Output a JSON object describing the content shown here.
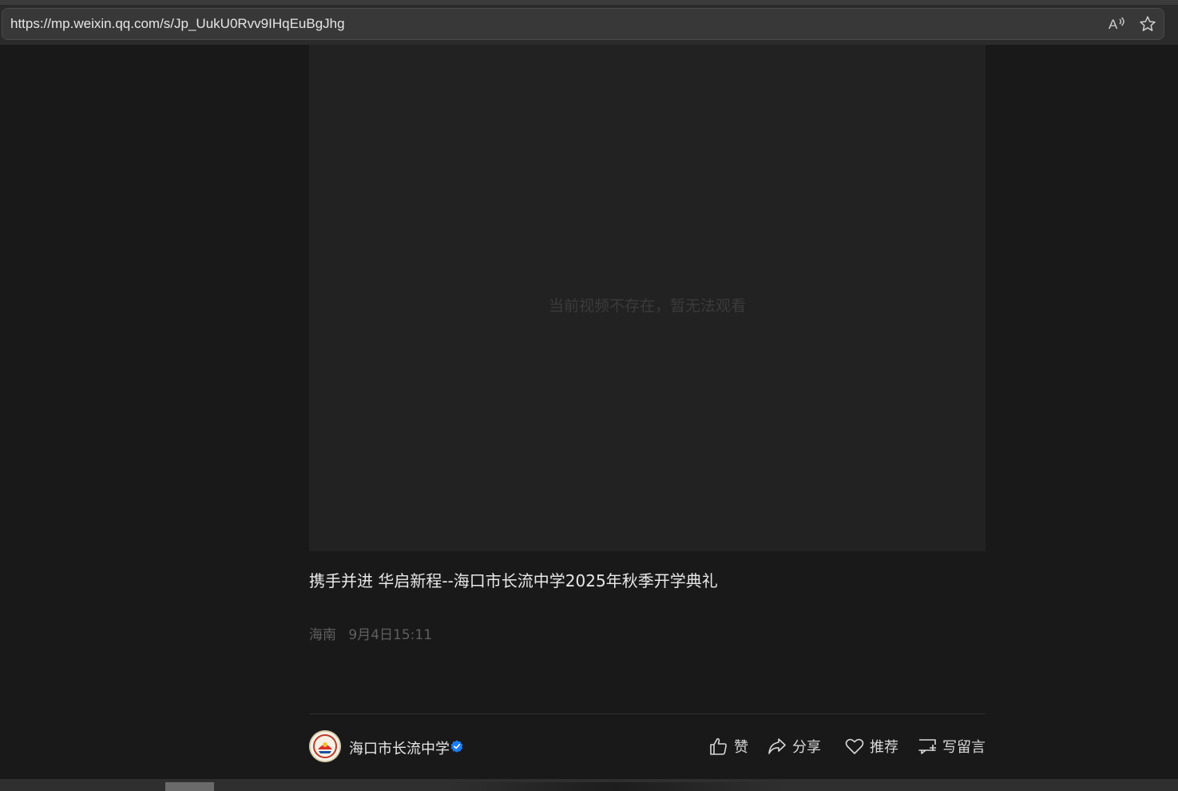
{
  "browser": {
    "url": "https://mp.weixin.qq.com/s/Jp_UukU0Rvv9IHqEuBgJhg",
    "read_aloud_icon": "read-aloud-icon",
    "favorite_icon": "star-icon"
  },
  "video": {
    "message": "当前视频不存在，暂无法观看"
  },
  "article": {
    "title": "携手并进 华启新程--海口市长流中学2025年秋季开学典礼",
    "location": "海南",
    "datetime": "9月4日15:11"
  },
  "account": {
    "name": "海口市长流中学",
    "verified_color": "#1b7df5"
  },
  "actions": {
    "like": "赞",
    "share": "分享",
    "recommend": "推荐",
    "comment": "写留言"
  }
}
